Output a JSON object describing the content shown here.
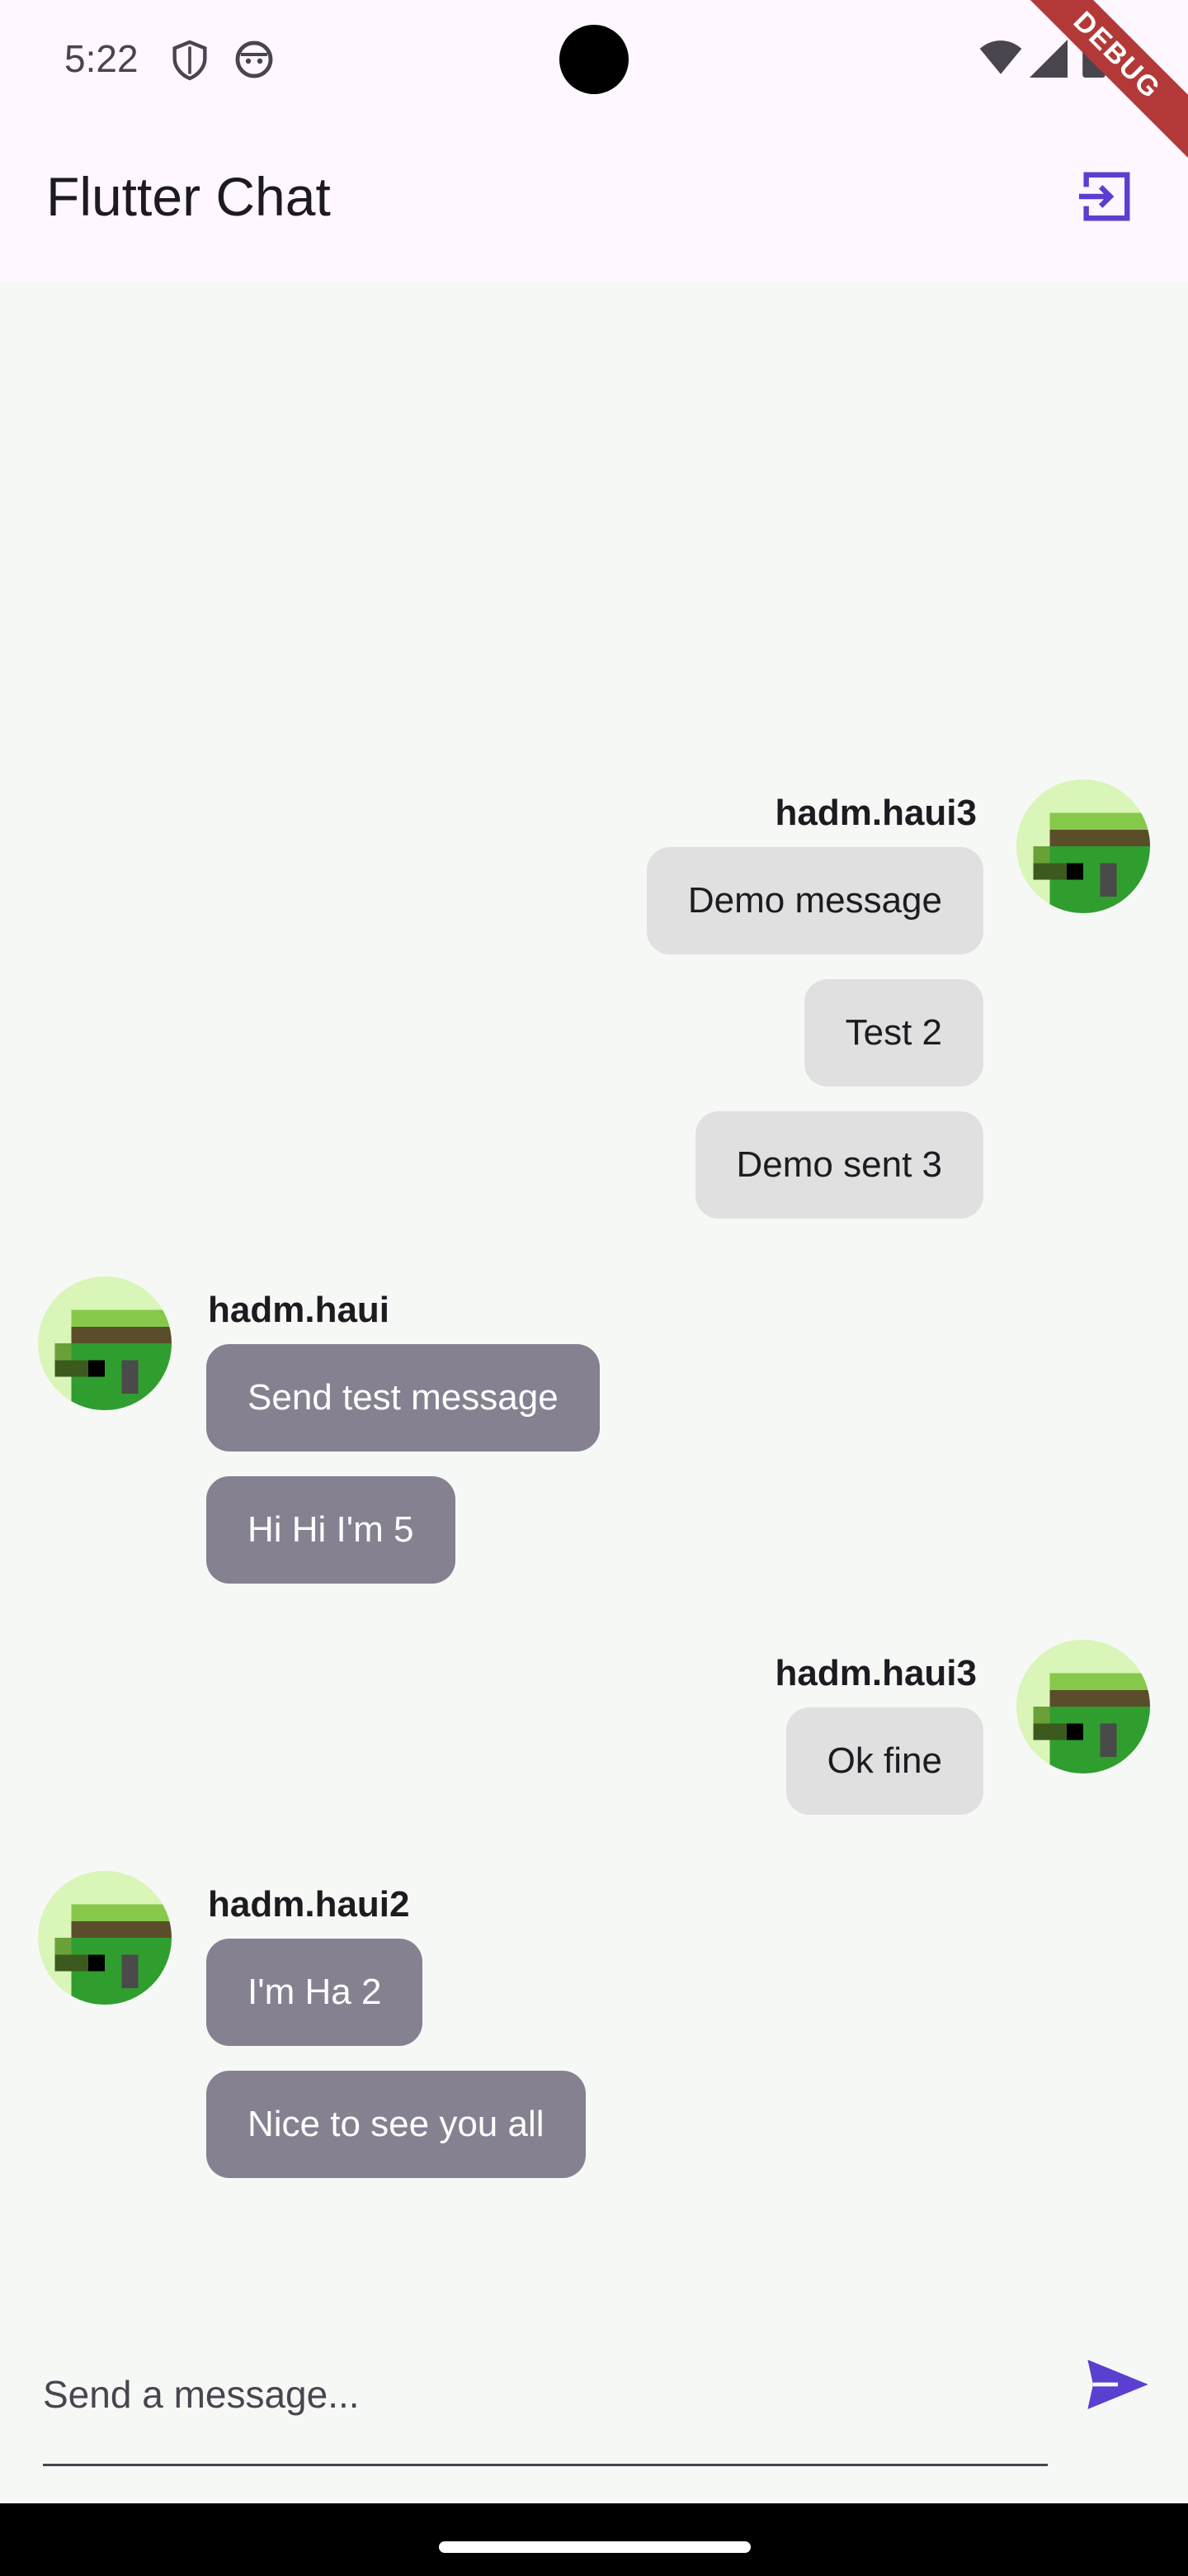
{
  "status_bar": {
    "time": "5:22"
  },
  "debug_banner": "DEBUG",
  "app_bar": {
    "title": "Flutter Chat",
    "action_icon": "logout-icon",
    "accent": "#5b3fd0"
  },
  "messages": [
    {
      "sender": "hadm.haui3",
      "side": "right",
      "text": "Demo message"
    },
    {
      "sender": "hadm.haui3",
      "side": "right",
      "text": "Test 2"
    },
    {
      "sender": "hadm.haui3",
      "side": "right",
      "text": "Demo sent 3"
    },
    {
      "sender": "hadm.haui",
      "side": "left",
      "text": "Send test message"
    },
    {
      "sender": "hadm.haui",
      "side": "left",
      "text": "Hi Hi I'm 5"
    },
    {
      "sender": "hadm.haui3",
      "side": "right",
      "text": "Ok fine"
    },
    {
      "sender": "hadm.haui2",
      "side": "left",
      "text": "I'm Ha 2"
    },
    {
      "sender": "hadm.haui2",
      "side": "left",
      "text": "Nice to see you all"
    }
  ],
  "composer": {
    "placeholder": "Send a message...",
    "send_icon": "send-icon"
  },
  "colors": {
    "my_bubble": "#e0e0e0",
    "their_bubble": "#858191",
    "chat_bg": "#f6f8f6"
  }
}
